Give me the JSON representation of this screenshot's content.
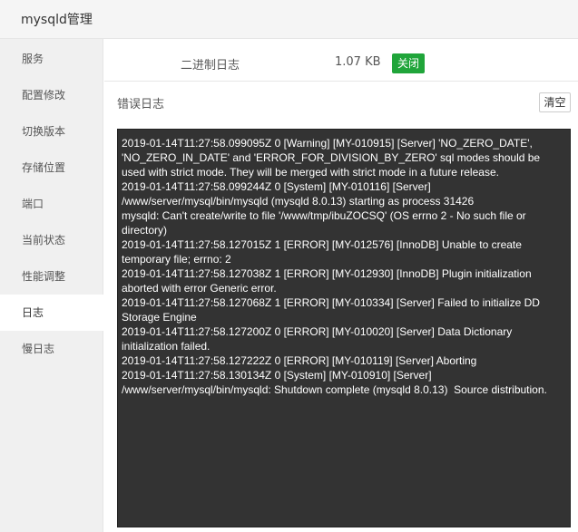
{
  "window": {
    "title": "mysqld管理"
  },
  "sidebar": {
    "items": [
      {
        "label": "服务"
      },
      {
        "label": "配置修改"
      },
      {
        "label": "切换版本"
      },
      {
        "label": "存储位置"
      },
      {
        "label": "端口"
      },
      {
        "label": "当前状态"
      },
      {
        "label": "性能调整"
      },
      {
        "label": "日志",
        "active": true
      },
      {
        "label": "慢日志"
      }
    ]
  },
  "binlog": {
    "label": "二进制日志",
    "size": "1.07 KB",
    "close_label": "关闭",
    "close_color": "#20a53a"
  },
  "errlog": {
    "label": "错误日志",
    "clear_label": "清空",
    "lines": [
      "2019-01-14T11:27:58.099095Z 0 [Warning] [MY-010915] [Server] 'NO_ZERO_DATE', 'NO_ZERO_IN_DATE' and 'ERROR_FOR_DIVISION_BY_ZERO' sql modes should be used with strict mode. They will be merged with strict mode in a future release.",
      "2019-01-14T11:27:58.099244Z 0 [System] [MY-010116] [Server] /www/server/mysql/bin/mysqld (mysqld 8.0.13) starting as process 31426",
      "mysqld: Can't create/write to file '/www/tmp/ibuZOCSQ' (OS errno 2 - No such file or directory)",
      "2019-01-14T11:27:58.127015Z 1 [ERROR] [MY-012576] [InnoDB] Unable to create temporary file; errno: 2",
      "2019-01-14T11:27:58.127038Z 1 [ERROR] [MY-012930] [InnoDB] Plugin initialization aborted with error Generic error.",
      "2019-01-14T11:27:58.127068Z 1 [ERROR] [MY-010334] [Server] Failed to initialize DD Storage Engine",
      "2019-01-14T11:27:58.127200Z 0 [ERROR] [MY-010020] [Server] Data Dictionary initialization failed.",
      "2019-01-14T11:27:58.127222Z 0 [ERROR] [MY-010119] [Server] Aborting",
      "2019-01-14T11:27:58.130134Z 0 [System] [MY-010910] [Server] /www/server/mysql/bin/mysqld: Shutdown complete (mysqld 8.0.13)  Source distribution."
    ]
  }
}
